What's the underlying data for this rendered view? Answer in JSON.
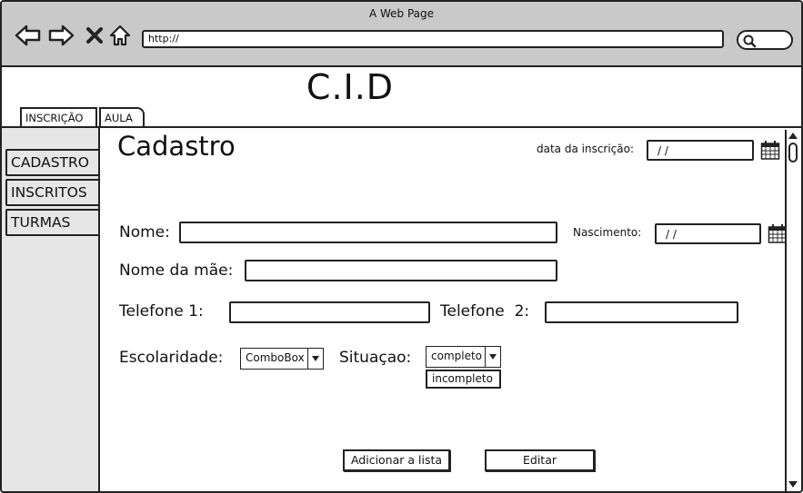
{
  "browser": {
    "window_title": "A Web Page",
    "url": "http://"
  },
  "app": {
    "title": "C.I.D"
  },
  "tabs": [
    {
      "label": "INSCRIÇÃO"
    },
    {
      "label": "AULA"
    }
  ],
  "sidebar": {
    "items": [
      {
        "label": "CADASTRO"
      },
      {
        "label": "INSCRITOS"
      },
      {
        "label": "TURMAS"
      }
    ]
  },
  "form": {
    "heading": "Cadastro",
    "registration_date_label": "data da inscrição:",
    "registration_date_value": "/ /",
    "name_label": "Nome:",
    "name_value": "",
    "birth_label": "Nascimento:",
    "birth_value": "/ /",
    "mother_label": "Nome da mãe:",
    "mother_value": "",
    "phone1_label": "Telefone 1:",
    "phone1_value": "",
    "phone2_label": "Telefone  2:",
    "phone2_value": "",
    "schooling_label": "Escolaridade:",
    "schooling_value": "ComboBox",
    "status_label": "Situaçao:",
    "status_value": "completo",
    "status_option_visible": "incompleto",
    "add_button": "Adicionar a lista",
    "edit_button": "Editar"
  }
}
